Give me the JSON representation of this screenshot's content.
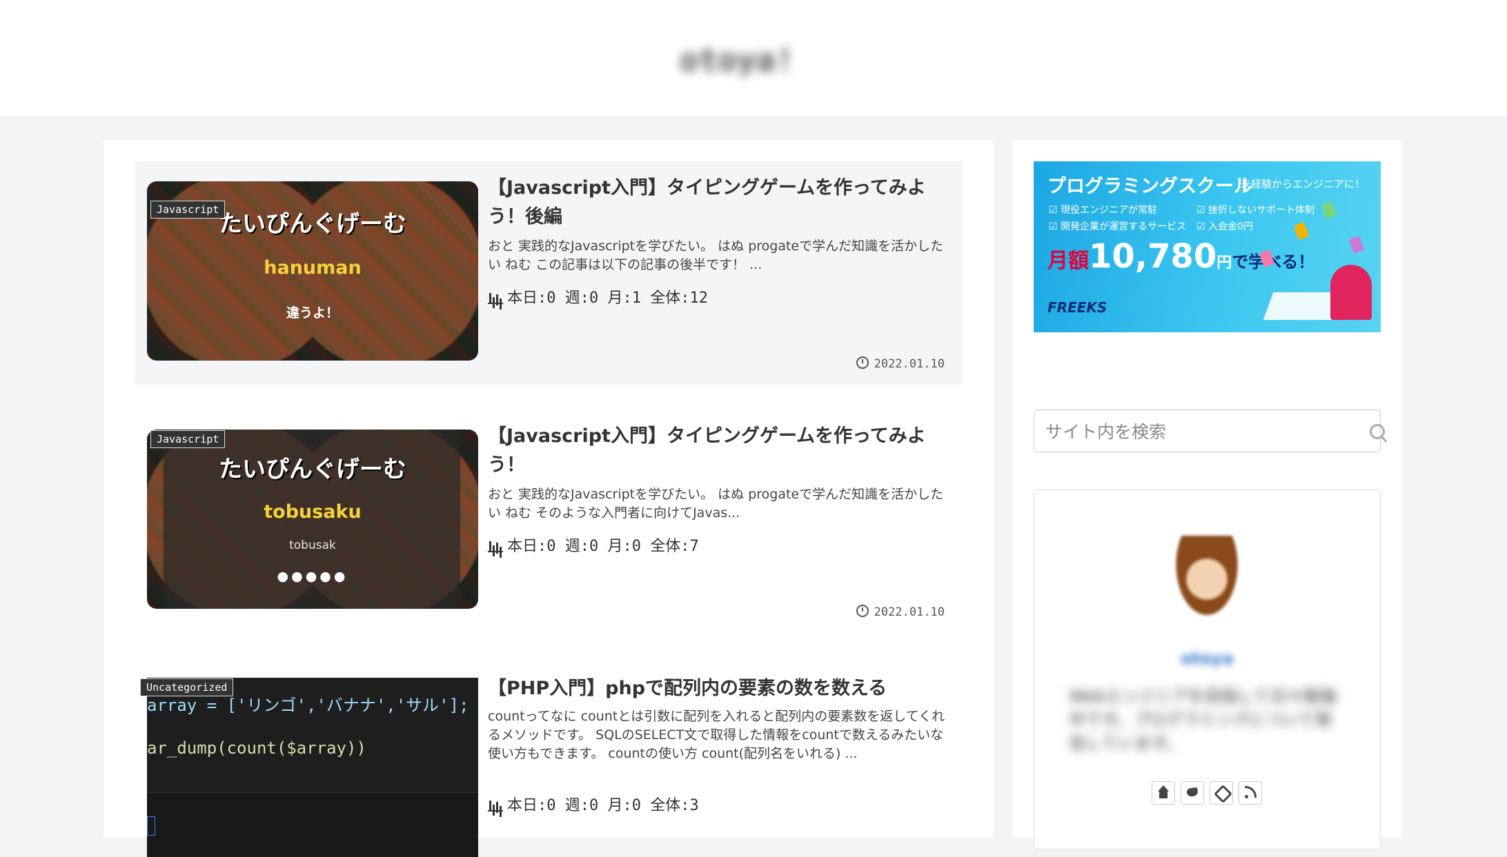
{
  "site": {
    "title": "otoya!"
  },
  "posts": [
    {
      "category": "Javascript",
      "title": "【Javascript入門】タイピングゲームを作ってみよう！後編",
      "excerpt": "おと 実践的なJavascriptを学びたい。 はぬ progateで学んだ知識を活かしたい ねむ この記事は以下の記事の後半です！ ...",
      "stats": "本日:0 週:0 月:1 全体:12",
      "date": "2022.01.10",
      "thumb": {
        "title": "たいぴんぐげーむ",
        "word": "hanuman",
        "sub": "違うよ！"
      }
    },
    {
      "category": "Javascript",
      "title": "【Javascript入門】タイピングゲームを作ってみよう！",
      "excerpt": "おと 実践的なJavascriptを学びたい。 はぬ progateで学んだ知識を活かしたい ねむ そのような入門者に向けてJavas...",
      "stats": "本日:0 週:0 月:0 全体:7",
      "date": "2022.01.10",
      "thumb": {
        "title": "たいぴんぐげーむ",
        "word": "tobusaku",
        "sub": "tobusak",
        "dots": "●●●●●"
      }
    },
    {
      "category": "Uncategorized",
      "title": "【PHP入門】phpで配列内の要素の数を数える",
      "excerpt": "countってなに countとは引数に配列を入れると配列内の要素数を返してくれるメソッドです。 SQLのSELECT文で取得した情報をcountで数えるみたいな使い方もできます。 countの使い方 count(配列名をいれる) ...",
      "stats": "本日:0 週:0 月:0 全体:3",
      "thumb": {
        "code_line1": "array = ['リンゴ','バナナ','サル'];",
        "code_line2": "ar_dump(count($array))"
      }
    }
  ],
  "sidebar": {
    "ad": {
      "title": "プログラミングスクール",
      "tagline": "未経験からエンジニアに！",
      "features": [
        "現役エンジニアが常駐",
        "挫折しないサポート体制",
        "開発企業が運営するサービス",
        "入会金0円"
      ],
      "price_prefix": "月額",
      "price": "10,780",
      "price_unit": "円",
      "price_suffix": "で学べる！",
      "logo": "FREEKS",
      "colors": {
        "accent": "#e4003a",
        "brand": "#1ca7e3"
      }
    },
    "search": {
      "placeholder": "サイト内を検索"
    },
    "profile": {
      "name": "otoya",
      "bio": "Webエンジニアを目指して日々勉強中です。プログラミングについて発信しています。"
    }
  }
}
